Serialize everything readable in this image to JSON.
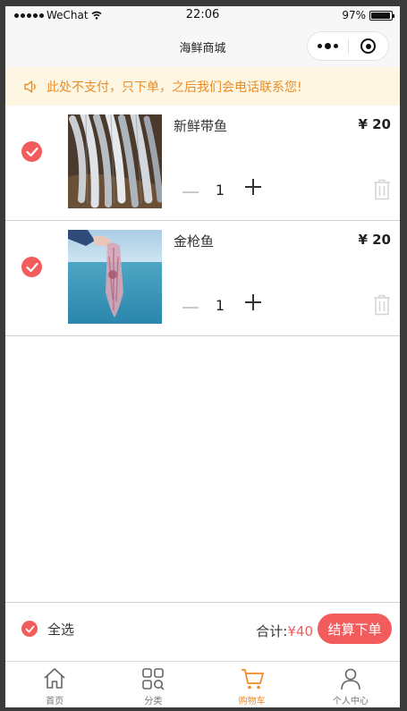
{
  "status_bar": {
    "carrier": "WeChat",
    "time": "22:06",
    "battery": "97%",
    "battery_level": 0.97
  },
  "nav": {
    "title": "海鲜商城"
  },
  "notice": {
    "text": "此处不支付，只下单，之后我们会电话联系您!"
  },
  "cart": {
    "items": [
      {
        "name": "新鲜带鱼",
        "price": "¥ 20",
        "qty": "1",
        "checked": true,
        "image": "hairtail-fish-photo"
      },
      {
        "name": "金枪鱼",
        "price": "¥ 20",
        "qty": "1",
        "checked": true,
        "image": "squid-photo"
      }
    ]
  },
  "footer": {
    "select_all": "全选",
    "total_label": "合计:",
    "total_value": "¥40",
    "checkout": "结算下单"
  },
  "tabbar": {
    "tabs": [
      {
        "label": "首页",
        "icon": "home-icon",
        "active": false
      },
      {
        "label": "分类",
        "icon": "category-icon",
        "active": false
      },
      {
        "label": "购物车",
        "icon": "cart-icon",
        "active": true
      },
      {
        "label": "个人中心",
        "icon": "user-icon",
        "active": false
      }
    ]
  },
  "colors": {
    "accent": "#f25c5c",
    "notice_text": "#e88d2a",
    "notice_bg": "#fdf6e3",
    "tab_active": "#f08a24"
  }
}
